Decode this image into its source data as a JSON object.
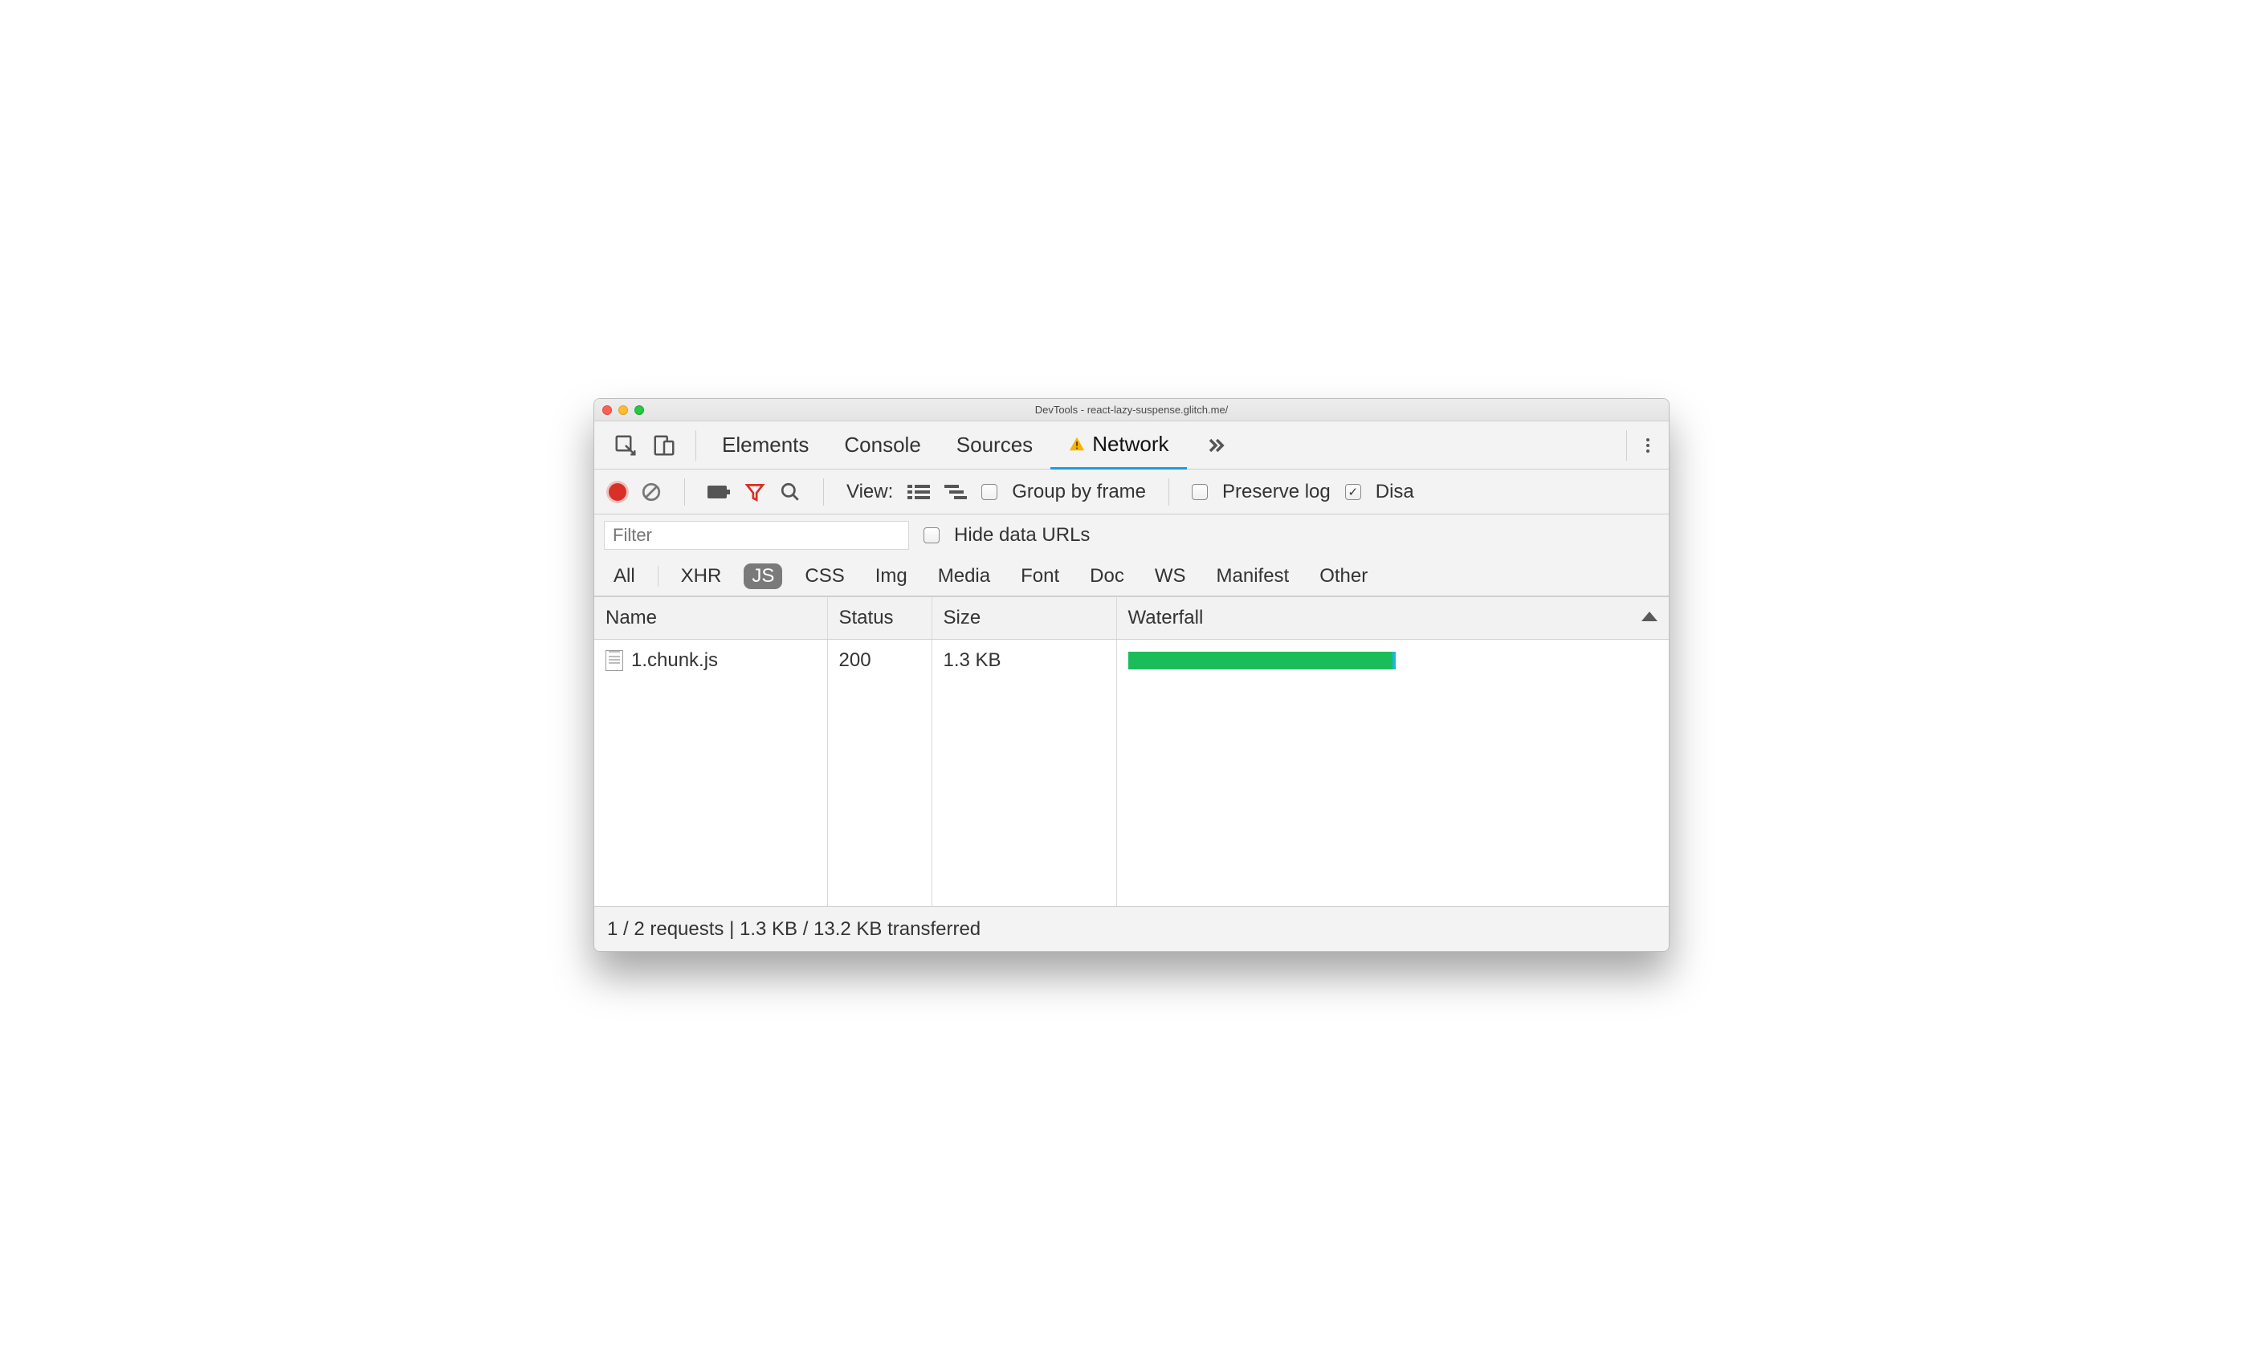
{
  "window": {
    "title": "DevTools - react-lazy-suspense.glitch.me/"
  },
  "tabs": {
    "items": [
      "Elements",
      "Console",
      "Sources",
      "Network"
    ],
    "active_index": 3,
    "has_warning_on_active": true
  },
  "toolbar": {
    "view_label": "View:",
    "group_by_frame": {
      "label": "Group by frame",
      "checked": false
    },
    "preserve_log": {
      "label": "Preserve log",
      "checked": false
    },
    "disable_cache": {
      "label_visible": "Disa",
      "checked": true
    }
  },
  "filter": {
    "placeholder": "Filter",
    "hide_data_urls": {
      "label": "Hide data URLs",
      "checked": false
    },
    "types": [
      "All",
      "XHR",
      "JS",
      "CSS",
      "Img",
      "Media",
      "Font",
      "Doc",
      "WS",
      "Manifest",
      "Other"
    ],
    "active_type_index": 2
  },
  "table": {
    "columns": [
      "Name",
      "Status",
      "Size",
      "Waterfall"
    ],
    "sort_column_index": 3,
    "rows": [
      {
        "name": "1.chunk.js",
        "status": "200",
        "size": "1.3 KB",
        "waterfall": {
          "start_pct": 0,
          "width_pct": 50
        }
      }
    ]
  },
  "statusbar": {
    "text": "1 / 2 requests | 1.3 KB / 13.2 KB transferred"
  }
}
